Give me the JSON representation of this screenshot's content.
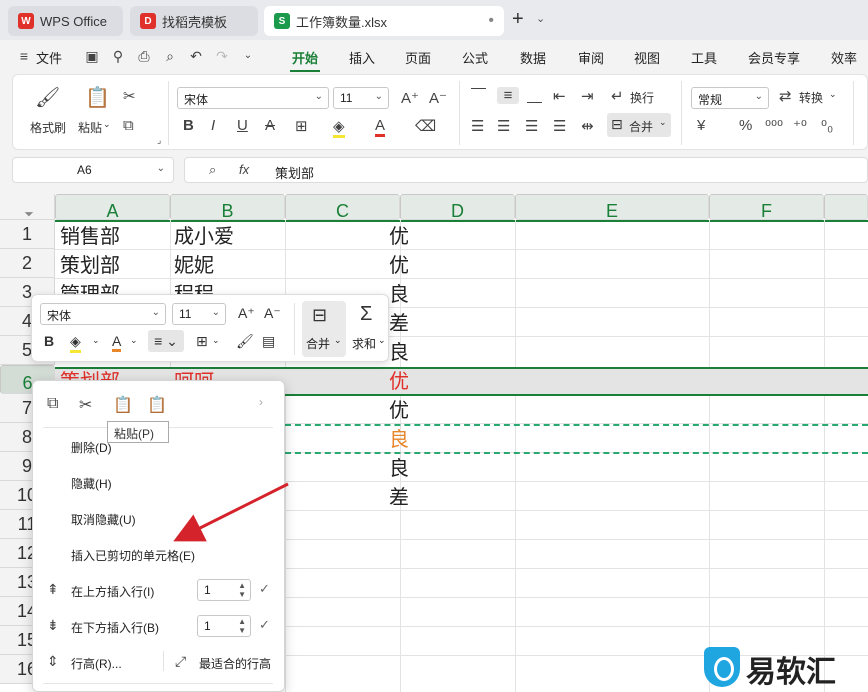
{
  "tabs": {
    "wps": "WPS Office",
    "templates": "找稻壳模板",
    "file": "工作簿数量.xlsx"
  },
  "menu": {
    "file": "文件",
    "items": [
      "开始",
      "插入",
      "页面",
      "公式",
      "数据",
      "审阅",
      "视图",
      "工具",
      "会员专享",
      "效率"
    ]
  },
  "ribbon": {
    "format_painter": "格式刷",
    "paste": "粘贴",
    "font_name": "宋体",
    "font_size": "11",
    "wrap": "换行",
    "merge": "合并",
    "number_format": "常规",
    "convert": "转换"
  },
  "formula": {
    "name_box": "A6",
    "fx": "fx",
    "value": "策划部"
  },
  "columns": [
    "A",
    "B",
    "C",
    "D",
    "E",
    "F"
  ],
  "rows": [
    "1",
    "2",
    "3",
    "4",
    "5",
    "6",
    "7",
    "8",
    "9",
    "10",
    "11",
    "12",
    "13",
    "14",
    "15",
    "16"
  ],
  "cells": {
    "r1": {
      "a": "销售部",
      "b": "成小爱",
      "d": "优"
    },
    "r2": {
      "a": "策划部",
      "b": "妮妮",
      "d": "优"
    },
    "r3": {
      "a": "管理部",
      "b": "程程",
      "d": "良"
    },
    "r4": {
      "d": "差"
    },
    "r5": {
      "d": "良"
    },
    "r6": {
      "a": "策划部",
      "b": "呵呵",
      "d": "优"
    },
    "r7": {
      "d": "优"
    },
    "r8": {
      "d": "良"
    },
    "r9": {
      "d": "良"
    },
    "r10": {
      "d": "差"
    }
  },
  "mini_toolbar": {
    "font_name": "宋体",
    "font_size": "11",
    "merge": "合并",
    "sum": "求和"
  },
  "context_menu": {
    "tooltip": "粘贴(P)",
    "delete": "删除(D)",
    "hide": "隐藏(H)",
    "unhide": "取消隐藏(U)",
    "insert_cut": "插入已剪切的单元格(E)",
    "insert_above": "在上方插入行(I)",
    "insert_above_count": "1",
    "insert_below": "在下方插入行(B)",
    "insert_below_count": "1",
    "row_height": "行高(R)...",
    "best_fit": "最适合的行高"
  },
  "watermark": "易软汇",
  "colors": {
    "accent": "#1a7f37",
    "red_text": "#e0302a",
    "orange_text": "#e8862a",
    "arrow": "#d4232a"
  }
}
